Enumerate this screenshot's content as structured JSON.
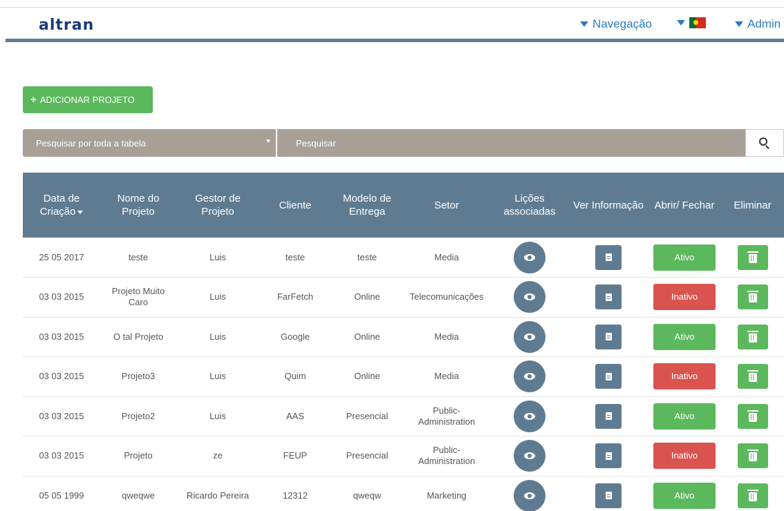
{
  "header": {
    "logo": "altran",
    "nav_label": "Navegação",
    "admin_label": "Admin",
    "flag": "portugal-flag-icon"
  },
  "toolbar": {
    "add_project_label": "ADICIONAR PROJETO",
    "search_scope": "Pesquisar por toda a tabela",
    "search_placeholder": "Pesquisar"
  },
  "table": {
    "headers": {
      "date": "Data de Criação",
      "name": "Nome do Projeto",
      "manager": "Gestor de Projeto",
      "client": "Cliente",
      "delivery": "Modelo de Entrega",
      "sector": "Setor",
      "lessons": "Lições associadas",
      "info": "Ver Informação",
      "toggle": "Abrir/ Fechar",
      "delete": "Eliminar"
    },
    "rows": [
      {
        "date": "25 05 2017",
        "name": "teste",
        "manager": "Luis",
        "client": "teste",
        "delivery": "teste",
        "sector": "Media",
        "status": "Ativo"
      },
      {
        "date": "03 03 2015",
        "name": "Projeto Muito Caro",
        "manager": "Luis",
        "client": "FarFetch",
        "delivery": "Online",
        "sector": "Telecomunicações",
        "status": "Inativo"
      },
      {
        "date": "03 03 2015",
        "name": "O tal Projeto",
        "manager": "Luis",
        "client": "Google",
        "delivery": "Online",
        "sector": "Media",
        "status": "Ativo"
      },
      {
        "date": "03 03 2015",
        "name": "Projeto3",
        "manager": "Luis",
        "client": "Quim",
        "delivery": "Online",
        "sector": "Media",
        "status": "Inativo"
      },
      {
        "date": "03 03 2015",
        "name": "Projeto2",
        "manager": "Luis",
        "client": "AAS",
        "delivery": "Presencial",
        "sector": "Public-Administration",
        "status": "Ativo"
      },
      {
        "date": "03 03 2015",
        "name": "Projeto",
        "manager": "ze",
        "client": "FEUP",
        "delivery": "Presencial",
        "sector": "Public-Administration",
        "status": "Inativo"
      },
      {
        "date": "05 05 1999",
        "name": "qweqwe",
        "manager": "Ricardo Pereira",
        "client": "12312",
        "delivery": "qweqw",
        "sector": "Marketing",
        "status": "Ativo"
      }
    ]
  },
  "colors": {
    "header_bar": "#5f7b92",
    "active": "#5cb85c",
    "inactive": "#d9534f",
    "search_bg": "#a89f96",
    "logo": "#1a3a78",
    "nav_link": "#2a7bc4"
  }
}
